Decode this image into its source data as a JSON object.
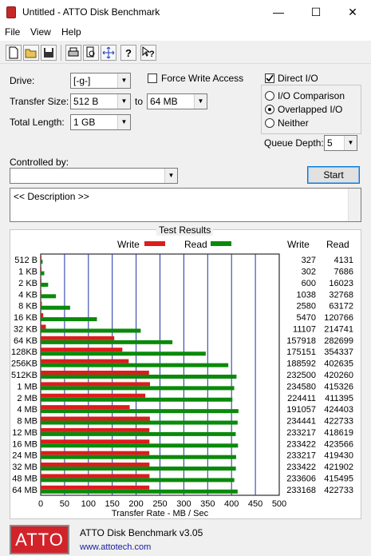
{
  "window": {
    "title": "Untitled - ATTO Disk Benchmark",
    "minimize": "—",
    "maximize": "☐",
    "close": "✕"
  },
  "menu": [
    "File",
    "View",
    "Help"
  ],
  "toolbar": {
    "buttons": [
      "new-icon",
      "open-icon",
      "save-icon",
      "print-icon",
      "print-preview-icon",
      "move-icon",
      "help-icon",
      "context-help-icon"
    ]
  },
  "form": {
    "drive_label": "Drive:",
    "drive_value": "[-g-]",
    "force_write_label": "Force Write Access",
    "direct_io_label": "Direct I/O",
    "transfer_size_label": "Transfer Size:",
    "transfer_from": "512 B",
    "to_label": "to",
    "transfer_to": "64 MB",
    "total_length_label": "Total Length:",
    "total_length_value": "1 GB",
    "io_comparison_label": "I/O Comparison",
    "overlapped_io_label": "Overlapped I/O",
    "neither_label": "Neither",
    "queue_depth_label": "Queue Depth:",
    "queue_depth_value": "5",
    "controlled_by_label": "Controlled by:",
    "controlled_by_value": "",
    "start_label": "Start",
    "description": "<< Description >>"
  },
  "results": {
    "title": "Test Results",
    "write_legend": "Write",
    "read_legend": "Read",
    "write_col_header": "Write",
    "read_col_header": "Read"
  },
  "chart_data": {
    "type": "bar",
    "orientation": "horizontal",
    "xlabel": "Transfer Rate - MB / Sec",
    "xlim": [
      0,
      500
    ],
    "xticks": [
      "0",
      "50",
      "100",
      "150",
      "200",
      "250",
      "300",
      "350",
      "400",
      "450",
      "500"
    ],
    "grid": true,
    "categories": [
      "512 B",
      "1 KB",
      "2 KB",
      "4 KB",
      "8 KB",
      "16 KB",
      "32 KB",
      "64 KB",
      "128KB",
      "256KB",
      "512KB",
      "1 MB",
      "2 MB",
      "4 MB",
      "8 MB",
      "12 MB",
      "16 MB",
      "24 MB",
      "32 MB",
      "48 MB",
      "64 MB"
    ],
    "series": [
      {
        "name": "Write",
        "color": "#dd1c1c",
        "values": [
          0.3,
          0.3,
          0.6,
          1.0,
          2.5,
          5.3,
          10.8,
          154.2,
          171.1,
          184.5,
          227.1,
          229.1,
          219.2,
          186.6,
          228.9,
          227.8,
          228.0,
          227.7,
          228.0,
          228.1,
          227.7
        ]
      },
      {
        "name": "Read",
        "color": "#0a8a0a",
        "values": [
          4.0,
          7.5,
          15.6,
          32.0,
          61.7,
          117.9,
          209.7,
          276.1,
          346.0,
          393.2,
          410.4,
          405.6,
          401.8,
          414.5,
          412.8,
          408.8,
          413.6,
          409.6,
          409.1,
          405.8,
          412.8
        ]
      }
    ],
    "table": {
      "write": [
        "327",
        "302",
        "600",
        "1038",
        "2580",
        "5470",
        "11107",
        "157918",
        "175151",
        "188592",
        "232500",
        "234580",
        "224411",
        "191057",
        "234441",
        "233217",
        "233422",
        "233217",
        "233422",
        "233606",
        "233168"
      ],
      "read": [
        "4131",
        "7686",
        "16023",
        "32768",
        "63172",
        "120766",
        "214741",
        "282699",
        "354337",
        "402635",
        "420260",
        "415326",
        "411395",
        "424403",
        "422733",
        "418619",
        "423566",
        "419430",
        "421902",
        "415495",
        "422733"
      ]
    }
  },
  "footer": {
    "logo": "ATTO",
    "app_name": "ATTO Disk Benchmark v3.05",
    "url": "www.attotech.com"
  }
}
